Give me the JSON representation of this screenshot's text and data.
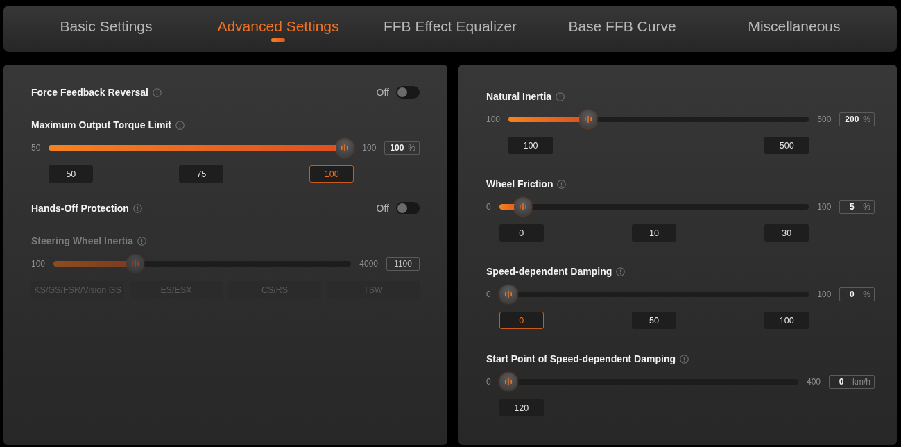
{
  "tabs": [
    {
      "label": "Basic Settings",
      "selected": false
    },
    {
      "label": "Advanced Settings",
      "selected": true
    },
    {
      "label": "FFB Effect Equalizer",
      "selected": false
    },
    {
      "label": "Base FFB Curve",
      "selected": false
    },
    {
      "label": "Miscellaneous",
      "selected": false
    }
  ],
  "panels": [
    {
      "items": [
        {
          "kind": "toggle",
          "title": "Force Feedback Reversal",
          "disabled": false,
          "on": false,
          "state_label": "Off"
        },
        {
          "kind": "slider",
          "title": "Maximum Output Torque Limit",
          "disabled": false,
          "min_label": "50",
          "max_label": "100",
          "level": 1,
          "value": "100",
          "unit": "%",
          "presets": [
            {
              "label": "50",
              "selected": false
            },
            {
              "label": "75",
              "selected": false
            },
            {
              "label": "100",
              "selected": true
            }
          ]
        },
        {
          "kind": "toggle",
          "title": "Hands-Off Protection",
          "disabled": false,
          "on": false,
          "state_label": "Off"
        },
        {
          "kind": "models",
          "title": "Steering Wheel Inertia",
          "disabled": true,
          "min_label": "100",
          "max_label": "4000",
          "level": 0.26,
          "value": "1100",
          "presets": [
            {
              "label": "KS/GS/FSR/Vision GS",
              "selected": false
            },
            {
              "label": "ES/ESX",
              "selected": false
            },
            {
              "label": "CS/RS",
              "selected": false
            },
            {
              "label": "TSW",
              "selected": false
            }
          ]
        }
      ]
    },
    {
      "items": [
        {
          "kind": "slider",
          "title": "Natural Inertia",
          "disabled": false,
          "min_label": "100",
          "max_label": "500",
          "level": 0.25,
          "value": "200",
          "unit": "%",
          "presets": [
            {
              "label": "100",
              "selected": false
            },
            {
              "label": "500",
              "selected": false
            }
          ]
        },
        {
          "kind": "slider",
          "title": "Wheel Friction",
          "disabled": false,
          "min_label": "0",
          "max_label": "100",
          "level": 0.05,
          "value": "5",
          "unit": "%",
          "presets": [
            {
              "label": "0",
              "selected": false
            },
            {
              "label": "10",
              "selected": false
            },
            {
              "label": "30",
              "selected": false
            }
          ]
        },
        {
          "kind": "slider",
          "title": "Speed-dependent Damping",
          "disabled": false,
          "min_label": "0",
          "max_label": "100",
          "level": 0,
          "value": "0",
          "unit": "%",
          "presets": [
            {
              "label": "0",
              "selected": true
            },
            {
              "label": "50",
              "selected": false
            },
            {
              "label": "100",
              "selected": false
            }
          ]
        },
        {
          "kind": "slider",
          "title": "Start Point of Speed-dependent Damping",
          "disabled": false,
          "min_label": "0",
          "max_label": "400",
          "level": 0,
          "value": "0",
          "unit": "km/h",
          "presets": [
            {
              "label": "120",
              "selected": false
            }
          ]
        }
      ]
    }
  ]
}
